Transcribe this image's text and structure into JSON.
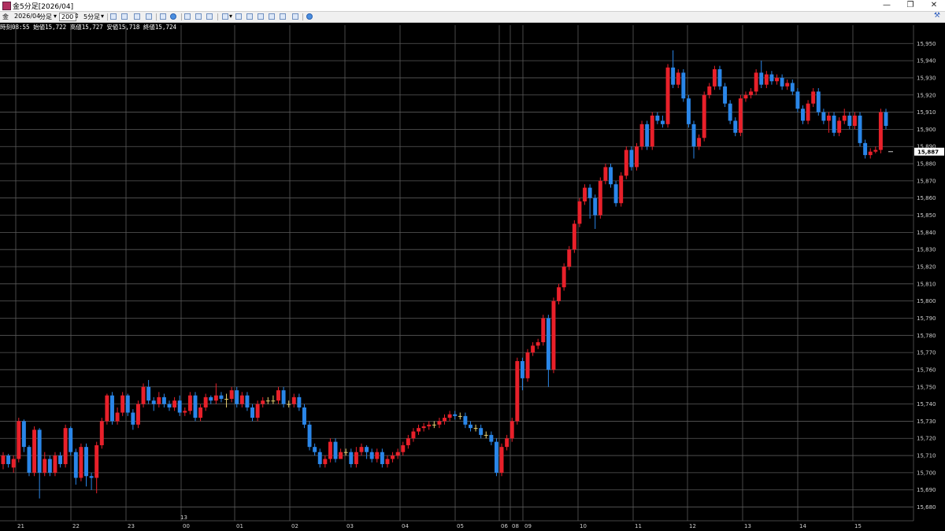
{
  "window": {
    "title": "金5分足[2026/04]",
    "minimize_glyph": "—",
    "restore_glyph": "❐",
    "close_glyph": "✕"
  },
  "toolbar": {
    "symbol": "金",
    "contract": "2026/04",
    "period_type": "分足",
    "bar_count": "200",
    "timeframe": "5分足",
    "icons": [
      "select-icon",
      "hand-icon",
      "pencil-icon",
      "line-icon",
      "cursor-icon",
      "zoom-icon",
      "table-icon",
      "grid-icon",
      "bar-chart-icon",
      "candle-icon",
      "line-chart-icon",
      "indicator-icon",
      "area-icon",
      "volume-icon",
      "refresh-icon"
    ],
    "settings_icon": "wrench-icon"
  },
  "infobar": {
    "time_label": "時刻",
    "time": "08:55",
    "open_label": "始値",
    "open": "15,722",
    "high_label": "高値",
    "high": "15,727",
    "low_label": "安値",
    "low": "15,718",
    "close_label": "終値",
    "close": "15,724"
  },
  "chart_data": {
    "type": "candlestick",
    "ylim": [
      15672,
      15957
    ],
    "grid": true,
    "y_ticks": [
      "15,680",
      "15,690",
      "15,700",
      "15,710",
      "15,720",
      "15,730",
      "15,740",
      "15,750",
      "15,760",
      "15,770",
      "15,780",
      "15,790",
      "15,800",
      "15,810",
      "15,820",
      "15,830",
      "15,840",
      "15,850",
      "15,860",
      "15,870",
      "15,880",
      "15,890",
      "15,900",
      "15,910",
      "15,920",
      "15,930",
      "15,940",
      "15,950"
    ],
    "x_labels": [
      "21",
      "22",
      "23",
      "00",
      "01",
      "02",
      "03",
      "04",
      "05",
      "06",
      "08",
      "09",
      "10",
      "11",
      "12",
      "13",
      "14",
      "15"
    ],
    "x_top_label": "13",
    "current_price": "15,887",
    "colors": {
      "up": "#e8202a",
      "down": "#2a86e8",
      "doji": "#e8d070",
      "background": "#000000",
      "grid": "#5a5a5a"
    },
    "candles": [
      [
        15705,
        15710,
        15702,
        15712
      ],
      [
        15710,
        15705,
        15703,
        15711
      ],
      [
        15703,
        15708,
        15700,
        15710
      ],
      [
        15708,
        15730,
        15706,
        15732
      ],
      [
        15730,
        15715,
        15712,
        15731
      ],
      [
        15715,
        15700,
        15698,
        15716
      ],
      [
        15700,
        15725,
        15698,
        15727
      ],
      [
        15725,
        15700,
        15685,
        15726
      ],
      [
        15700,
        15708,
        15698,
        15712
      ],
      [
        15708,
        15700,
        15698,
        15710
      ],
      [
        15700,
        15710,
        15698,
        15712
      ],
      [
        15710,
        15705,
        15703,
        15712
      ],
      [
        15705,
        15726,
        15703,
        15728
      ],
      [
        15726,
        15712,
        15710,
        15727
      ],
      [
        15712,
        15697,
        15693,
        15714
      ],
      [
        15697,
        15715,
        15695,
        15717
      ],
      [
        15715,
        15698,
        15692,
        15717
      ],
      [
        15698,
        15697,
        15690,
        15700
      ],
      [
        15697,
        15716,
        15688,
        15718
      ],
      [
        15716,
        15730,
        15714,
        15732
      ],
      [
        15730,
        15745,
        15728,
        15746
      ],
      [
        15745,
        15730,
        15728,
        15747
      ],
      [
        15730,
        15735,
        15728,
        15738
      ],
      [
        15735,
        15745,
        15733,
        15747
      ],
      [
        15745,
        15735,
        15733,
        15746
      ],
      [
        15735,
        15728,
        15725,
        15737
      ],
      [
        15728,
        15740,
        15726,
        15742
      ],
      [
        15740,
        15750,
        15738,
        15752
      ],
      [
        15750,
        15742,
        15740,
        15754
      ],
      [
        15742,
        15740,
        15736,
        15744
      ],
      [
        15740,
        15744,
        15738,
        15747
      ],
      [
        15744,
        15740,
        15738,
        15746
      ],
      [
        15740,
        15738,
        15736,
        15742
      ],
      [
        15738,
        15742,
        15736,
        15744
      ],
      [
        15742,
        15735,
        15733,
        15745
      ],
      [
        15735,
        15736,
        15733,
        15738
      ],
      [
        15736,
        15745,
        15734,
        15747
      ],
      [
        15745,
        15732,
        15730,
        15747
      ],
      [
        15732,
        15738,
        15730,
        15740
      ],
      [
        15738,
        15744,
        15736,
        15746
      ],
      [
        15744,
        15742,
        15740,
        15745
      ],
      [
        15742,
        15745,
        15740,
        15752
      ],
      [
        15745,
        15743,
        15741,
        15747
      ],
      [
        15743,
        15743,
        15738,
        15746
      ],
      [
        15743,
        15748,
        15741,
        15750
      ],
      [
        15748,
        15740,
        15738,
        15750
      ],
      [
        15740,
        15745,
        15738,
        15747
      ],
      [
        15745,
        15738,
        15736,
        15747
      ],
      [
        15738,
        15732,
        15730,
        15740
      ],
      [
        15732,
        15740,
        15730,
        15742
      ],
      [
        15740,
        15742,
        15738,
        15744
      ],
      [
        15742,
        15742,
        15740,
        15744
      ],
      [
        15742,
        15742,
        15740,
        15745
      ],
      [
        15742,
        15748,
        15740,
        15750
      ],
      [
        15748,
        15740,
        15738,
        15750
      ],
      [
        15740,
        15740,
        15738,
        15742
      ],
      [
        15740,
        15744,
        15738,
        15746
      ],
      [
        15744,
        15738,
        15736,
        15746
      ],
      [
        15738,
        15728,
        15726,
        15740
      ],
      [
        15728,
        15715,
        15713,
        15730
      ],
      [
        15715,
        15712,
        15710,
        15717
      ],
      [
        15712,
        15705,
        15703,
        15714
      ],
      [
        15705,
        15708,
        15703,
        15710
      ],
      [
        15708,
        15718,
        15706,
        15720
      ],
      [
        15718,
        15708,
        15706,
        15720
      ],
      [
        15708,
        15712,
        15710,
        15714
      ],
      [
        15712,
        15712,
        15710,
        15714
      ],
      [
        15712,
        15705,
        15703,
        15714
      ],
      [
        15705,
        15712,
        15703,
        15715
      ],
      [
        15712,
        15715,
        15710,
        15717
      ],
      [
        15715,
        15712,
        15708,
        15716
      ],
      [
        15712,
        15708,
        15706,
        15714
      ],
      [
        15708,
        15712,
        15706,
        15714
      ],
      [
        15712,
        15705,
        15703,
        15714
      ],
      [
        15705,
        15708,
        15703,
        15710
      ],
      [
        15708,
        15710,
        15706,
        15712
      ],
      [
        15710,
        15712,
        15708,
        15714
      ],
      [
        15712,
        15716,
        15710,
        15718
      ],
      [
        15716,
        15720,
        15714,
        15722
      ],
      [
        15720,
        15724,
        15718,
        15726
      ],
      [
        15724,
        15726,
        15722,
        15728
      ],
      [
        15726,
        15727,
        15724,
        15729
      ],
      [
        15727,
        15728,
        15725,
        15730
      ],
      [
        15728,
        15728,
        15726,
        15730
      ],
      [
        15728,
        15730,
        15726,
        15732
      ],
      [
        15730,
        15732,
        15728,
        15734
      ],
      [
        15732,
        15734,
        15730,
        15736
      ],
      [
        15734,
        15733,
        15731,
        15736
      ],
      [
        15733,
        15733,
        15731,
        15735
      ],
      [
        15733,
        15728,
        15726,
        15735
      ],
      [
        15728,
        15726,
        15724,
        15730
      ],
      [
        15726,
        15726,
        15724,
        15728
      ],
      [
        15726,
        15722,
        15720,
        15728
      ],
      [
        15722,
        15722,
        15720,
        15724
      ],
      [
        15722,
        15718,
        15716,
        15724
      ],
      [
        15718,
        15700,
        15698,
        15720
      ],
      [
        15700,
        15715,
        15698,
        15717
      ],
      [
        15715,
        15720,
        15713,
        15722
      ],
      [
        15720,
        15730,
        15718,
        15732
      ],
      [
        15730,
        15765,
        15728,
        15767
      ],
      [
        15765,
        15755,
        15748,
        15767
      ],
      [
        15755,
        15770,
        15753,
        15772
      ],
      [
        15770,
        15774,
        15768,
        15776
      ],
      [
        15774,
        15776,
        15772,
        15778
      ],
      [
        15776,
        15790,
        15774,
        15792
      ],
      [
        15790,
        15760,
        15750,
        15792
      ],
      [
        15760,
        15800,
        15758,
        15802
      ],
      [
        15800,
        15808,
        15798,
        15810
      ],
      [
        15808,
        15820,
        15806,
        15822
      ],
      [
        15820,
        15830,
        15818,
        15832
      ],
      [
        15830,
        15845,
        15828,
        15847
      ],
      [
        15845,
        15858,
        15843,
        15860
      ],
      [
        15858,
        15866,
        15856,
        15868
      ],
      [
        15866,
        15860,
        15848,
        15868
      ],
      [
        15860,
        15850,
        15842,
        15862
      ],
      [
        15850,
        15870,
        15848,
        15872
      ],
      [
        15870,
        15878,
        15868,
        15880
      ],
      [
        15878,
        15868,
        15866,
        15880
      ],
      [
        15868,
        15857,
        15855,
        15870
      ],
      [
        15857,
        15873,
        15855,
        15875
      ],
      [
        15873,
        15888,
        15871,
        15890
      ],
      [
        15888,
        15878,
        15876,
        15890
      ],
      [
        15878,
        15890,
        15876,
        15892
      ],
      [
        15890,
        15903,
        15888,
        15905
      ],
      [
        15903,
        15890,
        15888,
        15905
      ],
      [
        15890,
        15908,
        15888,
        15910
      ],
      [
        15908,
        15905,
        15903,
        15910
      ],
      [
        15905,
        15903,
        15901,
        15908
      ],
      [
        15903,
        15936,
        15901,
        15938
      ],
      [
        15936,
        15926,
        15924,
        15946
      ],
      [
        15926,
        15933,
        15924,
        15935
      ],
      [
        15933,
        15918,
        15916,
        15935
      ],
      [
        15918,
        15903,
        15901,
        15920
      ],
      [
        15903,
        15890,
        15883,
        15905
      ],
      [
        15890,
        15895,
        15888,
        15897
      ],
      [
        15895,
        15920,
        15893,
        15922
      ],
      [
        15920,
        15925,
        15918,
        15927
      ],
      [
        15925,
        15935,
        15923,
        15937
      ],
      [
        15935,
        15925,
        15923,
        15937
      ],
      [
        15925,
        15915,
        15913,
        15927
      ],
      [
        15915,
        15905,
        15903,
        15917
      ],
      [
        15905,
        15898,
        15896,
        15907
      ],
      [
        15898,
        15918,
        15896,
        15920
      ],
      [
        15918,
        15920,
        15916,
        15922
      ],
      [
        15920,
        15922,
        15918,
        15924
      ],
      [
        15922,
        15933,
        15920,
        15935
      ],
      [
        15933,
        15926,
        15924,
        15940
      ],
      [
        15926,
        15932,
        15924,
        15934
      ],
      [
        15932,
        15928,
        15926,
        15934
      ],
      [
        15928,
        15930,
        15926,
        15932
      ],
      [
        15930,
        15925,
        15923,
        15932
      ],
      [
        15925,
        15927,
        15923,
        15929
      ],
      [
        15927,
        15922,
        15920,
        15929
      ],
      [
        15922,
        15912,
        15910,
        15924
      ],
      [
        15912,
        15905,
        15903,
        15914
      ],
      [
        15905,
        15915,
        15903,
        15917
      ],
      [
        15915,
        15922,
        15913,
        15924
      ],
      [
        15922,
        15910,
        15908,
        15924
      ],
      [
        15910,
        15905,
        15903,
        15912
      ],
      [
        15905,
        15908,
        15898,
        15910
      ],
      [
        15908,
        15898,
        15896,
        15910
      ],
      [
        15898,
        15905,
        15896,
        15907
      ],
      [
        15905,
        15908,
        15903,
        15912
      ],
      [
        15908,
        15902,
        15900,
        15910
      ],
      [
        15902,
        15908,
        15900,
        15910
      ],
      [
        15908,
        15892,
        15890,
        15910
      ],
      [
        15892,
        15885,
        15883,
        15894
      ],
      [
        15885,
        15887,
        15883,
        15889
      ],
      [
        15887,
        15888,
        15886,
        15890
      ],
      [
        15888,
        15910,
        15886,
        15912
      ],
      [
        15910,
        15902,
        15900,
        15912
      ]
    ]
  }
}
